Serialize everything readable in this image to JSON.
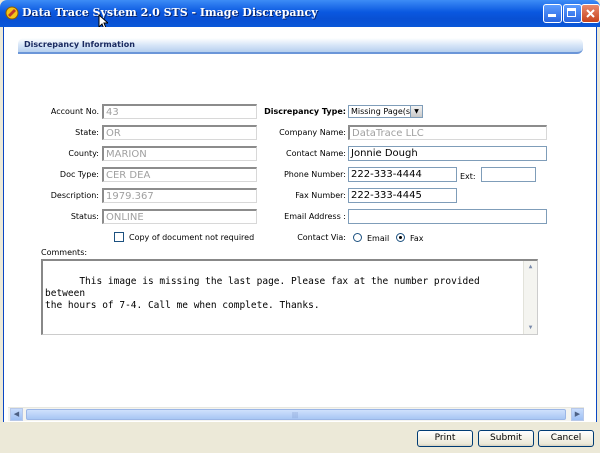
{
  "window": {
    "title": "Data Trace System 2.0 STS - Image Discrepancy"
  },
  "section": {
    "title": "Discrepancy Information"
  },
  "left": {
    "account_label": "Account No.",
    "account_value": "43",
    "state_label": "State:",
    "state_value": "OR",
    "county_label": "County:",
    "county_value": "MARION",
    "doctype_label": "Doc Type:",
    "doctype_value": "CER DEA",
    "description_label": "Description:",
    "description_value": "1979.367",
    "status_label": "Status:",
    "status_value": "ONLINE",
    "copy_not_required_label": "Copy of document not required"
  },
  "right": {
    "discrepancy_type_label": "Discrepancy Type:",
    "discrepancy_type_value": "Missing Page(s)",
    "company_label": "Company Name:",
    "company_value": "DataTrace LLC",
    "contact_label": "Contact Name:",
    "contact_value": "Jonnie Dough",
    "phone_label": "Phone Number:",
    "phone_value": "222-333-4444",
    "ext_label": "Ext:",
    "ext_value": "",
    "fax_label": "Fax Number:",
    "fax_value": "222-333-4445",
    "email_label": "Email Address :",
    "email_value": "",
    "contact_via_label": "Contact Via:",
    "via_email_label": "Email",
    "via_fax_label": "Fax"
  },
  "comments": {
    "label": "Comments:",
    "text": "This image is missing the last page. Please fax at the number provided between\nthe hours of 7-4. Call me when complete. Thanks."
  },
  "buttons": {
    "print": "Print",
    "submit": "Submit",
    "cancel": "Cancel"
  },
  "icons": {
    "app": "app-icon",
    "minimize": "minimize-icon",
    "maximize": "maximize-icon",
    "close": "close-icon"
  },
  "colors": {
    "titlebar": "#0a58e0",
    "section_bar": "#b6cfee"
  }
}
